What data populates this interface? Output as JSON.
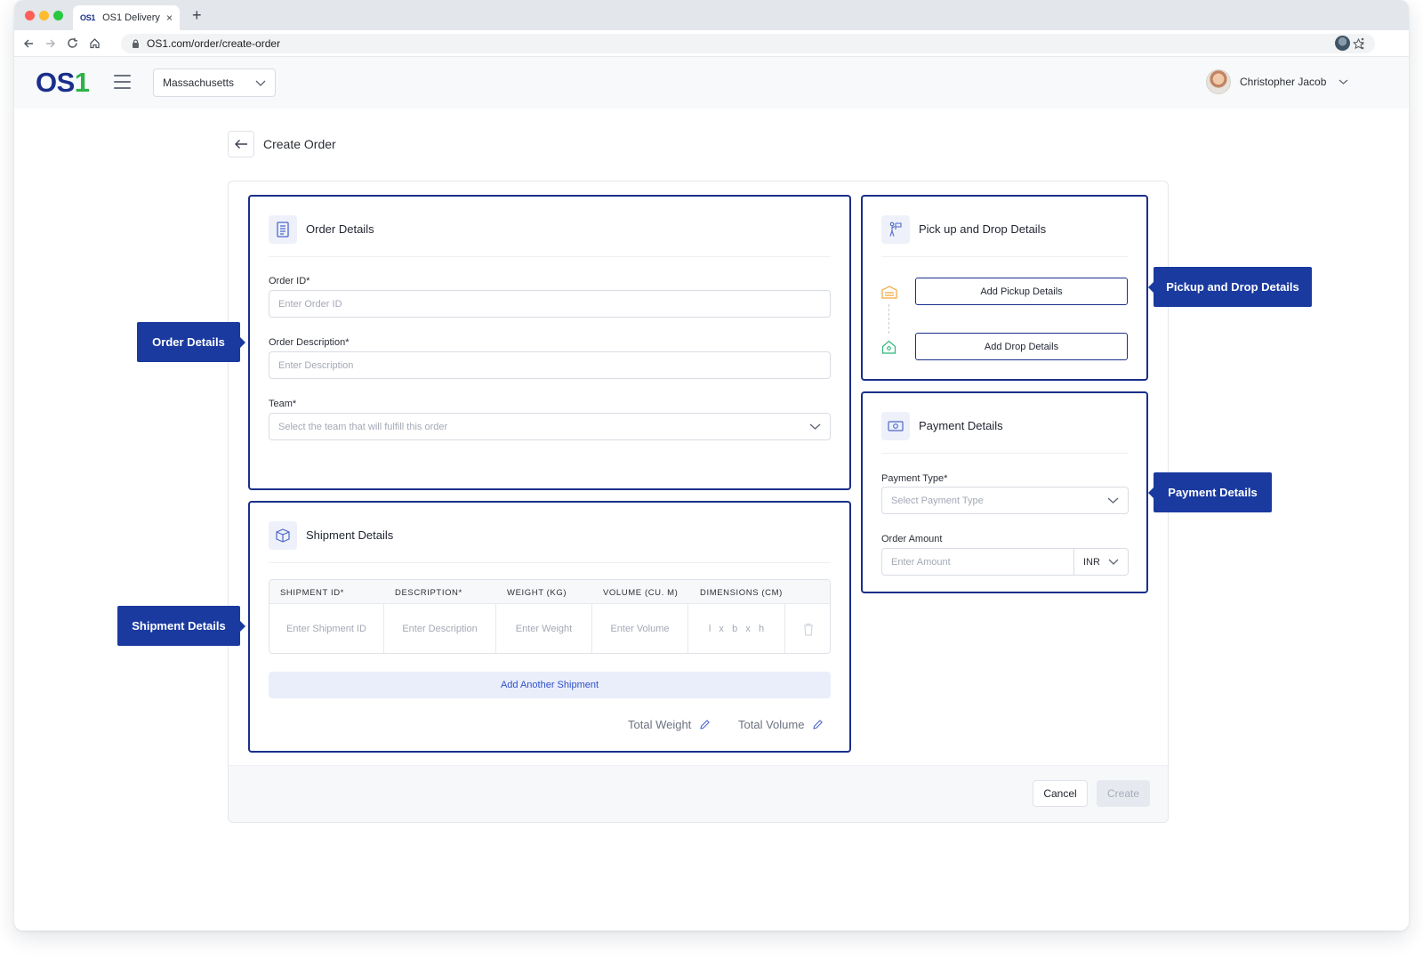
{
  "browser": {
    "tab_favicon": "OS1",
    "tab_title": "OS1 Delivery",
    "tab_close": "×",
    "new_tab": "+",
    "url": "OS1.com/order/create-order"
  },
  "header": {
    "logo_main": "OS",
    "logo_accent": "1",
    "region": "Massachusetts",
    "user_name": "Christopher Jacob"
  },
  "page": {
    "title": "Create Order",
    "cancel_label": "Cancel",
    "create_label": "Create"
  },
  "order_details": {
    "title": "Order Details",
    "order_id_label": "Order ID*",
    "order_id_placeholder": "Enter Order ID",
    "description_label": "Order Description*",
    "description_placeholder": "Enter Description",
    "team_label": "Team*",
    "team_placeholder": "Select the team that will fulfill this order"
  },
  "shipment_details": {
    "title": "Shipment Details",
    "columns": [
      "SHIPMENT ID*",
      "DESCRIPTION*",
      "WEIGHT (KG)",
      "VOLUME (CU. M)",
      "DIMENSIONS (CM)"
    ],
    "row_placeholders": [
      "Enter Shipment ID",
      "Enter Description",
      "Enter Weight",
      "Enter Volume",
      "l   x   b   x   h"
    ],
    "add_label": "Add Another Shipment",
    "total_weight_label": "Total Weight",
    "total_volume_label": "Total Volume"
  },
  "pickup_drop": {
    "title": "Pick up and Drop Details",
    "add_pickup_label": "Add Pickup Details",
    "add_drop_label": "Add Drop Details"
  },
  "payment": {
    "title": "Payment Details",
    "type_label": "Payment Type*",
    "type_placeholder": "Select Payment Type",
    "amount_label": "Order Amount",
    "amount_placeholder": "Enter Amount",
    "currency": "INR"
  },
  "callouts": {
    "order_details": "Order Details",
    "shipment_details": "Shipment Details",
    "pickup_drop": "Pickup and Drop Details",
    "payment": "Payment Details"
  },
  "colors": {
    "brand_blue": "#1a2f8a",
    "brand_green": "#2db24a",
    "callout_blue": "#1a3aa0",
    "link_blue": "#2f50c8"
  }
}
